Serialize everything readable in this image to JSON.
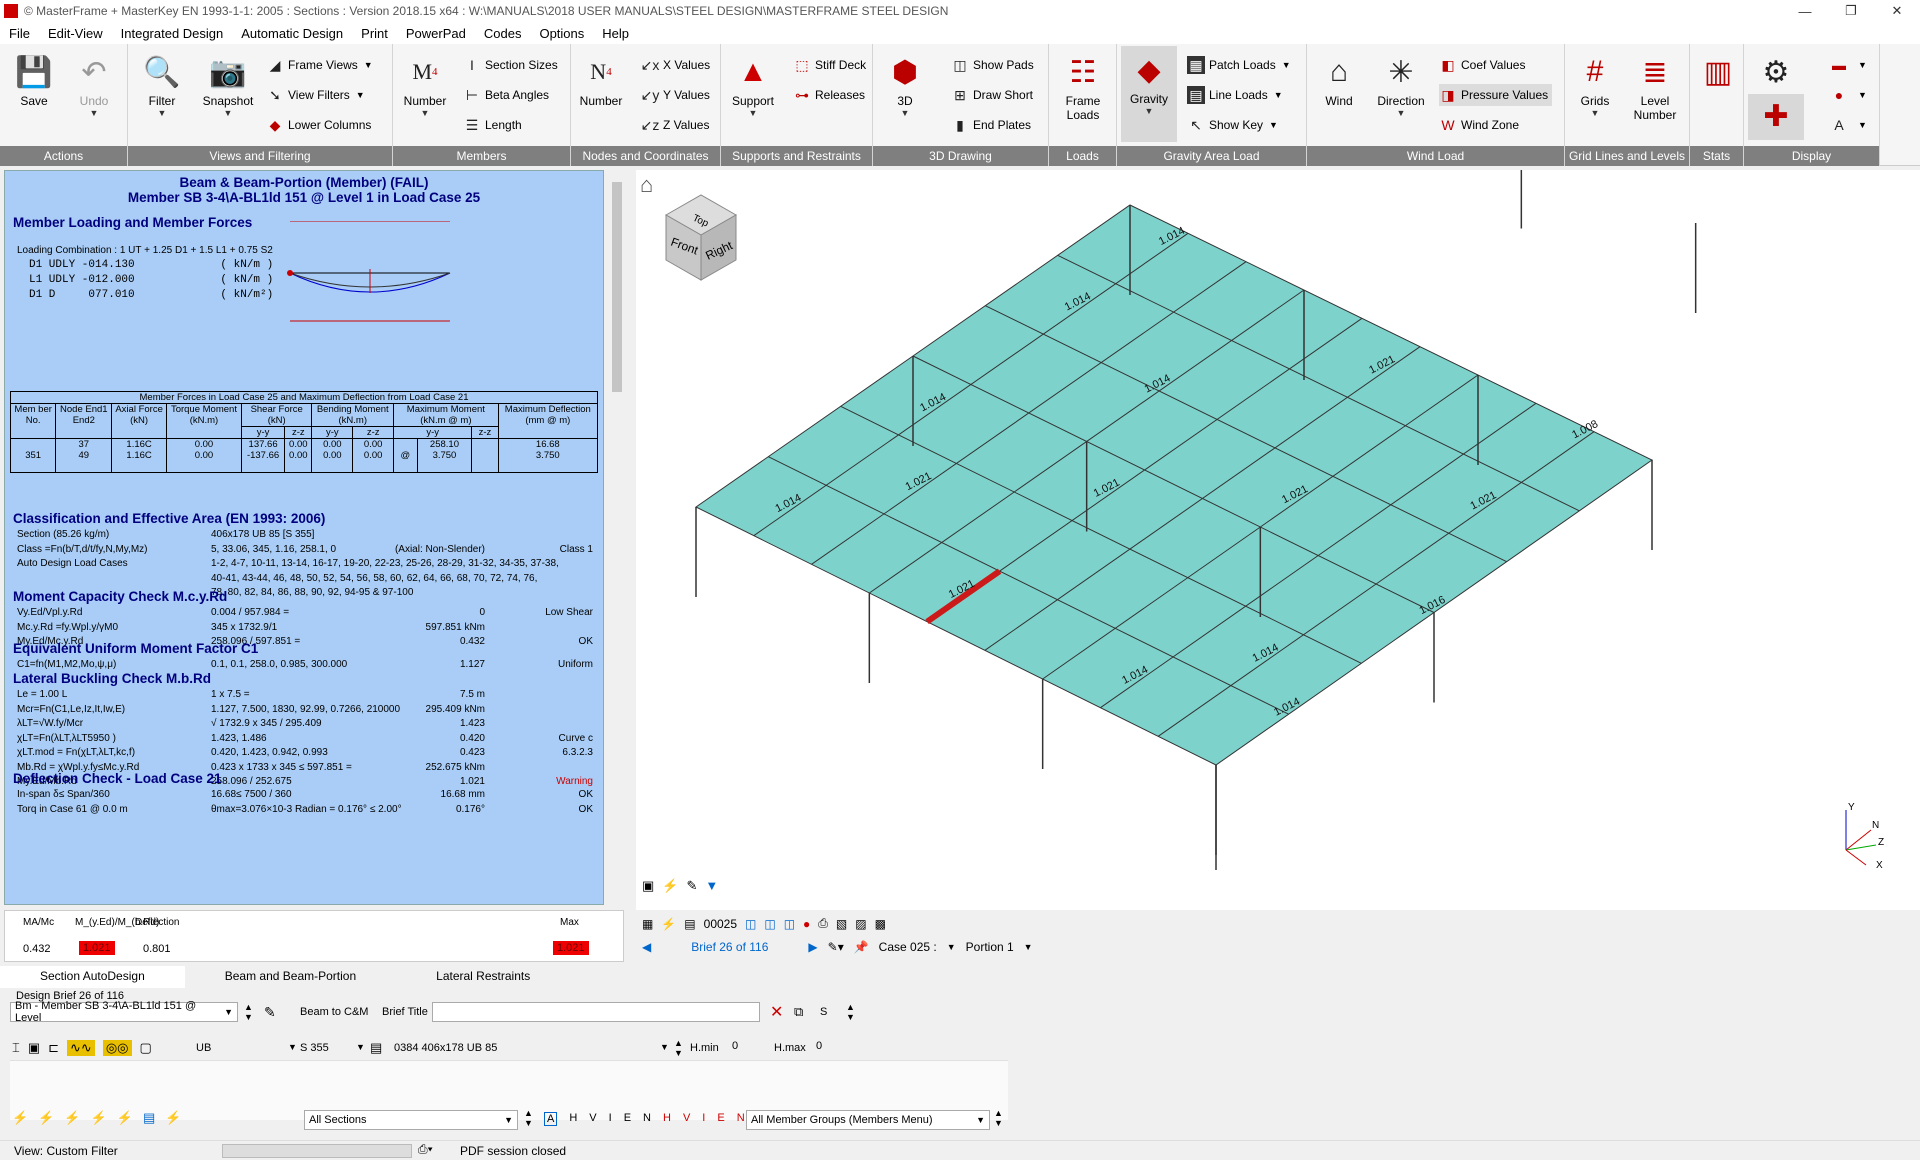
{
  "title_bar": {
    "text": "© MasterFrame + MasterKey EN 1993-1-1: 2005 : Sections : Version 2018.15 x64 : W:\\MANUALS\\2018 USER MANUALS\\STEEL DESIGN\\MASTERFRAME STEEL DESIGN"
  },
  "menu": [
    "File",
    "Edit-View",
    "Integrated Design",
    "Automatic Design",
    "Print",
    "PowerPad",
    "Codes",
    "Options",
    "Help"
  ],
  "ribbon": {
    "actions": {
      "title": "Actions",
      "save": "Save",
      "undo": "Undo"
    },
    "views": {
      "title": "Views and Filtering",
      "filter": "Filter",
      "snapshot": "Snapshot",
      "frame_views": "Frame Views",
      "view_filters": "View Filters",
      "lower_columns": "Lower Columns"
    },
    "members": {
      "title": "Members",
      "number": "Number",
      "section_sizes": "Section Sizes",
      "beta_angles": "Beta Angles",
      "length": "Length"
    },
    "nodes": {
      "title": "Nodes and Coordinates",
      "number": "Number",
      "x_values": "X Values",
      "y_values": "Y Values",
      "z_values": "Z Values"
    },
    "supports": {
      "title": "Supports and Restraints",
      "support": "Support",
      "stiff_deck": "Stiff Deck",
      "releases": "Releases"
    },
    "drawing": {
      "title": "3D Drawing",
      "btn_3d": "3D",
      "show_pads": "Show Pads",
      "draw_short": "Draw Short",
      "end_plates": "End Plates"
    },
    "loads": {
      "title": "Loads",
      "frame_loads": "Frame Loads"
    },
    "gravity": {
      "title": "Gravity Area Load",
      "gravity": "Gravity",
      "patch_loads": "Patch Loads",
      "line_loads": "Line Loads",
      "show_key": "Show Key"
    },
    "wind": {
      "title": "Wind Load",
      "wind": "Wind",
      "direction": "Direction",
      "coef_values": "Coef Values",
      "pressure_values": "Pressure Values",
      "wind_zone": "Wind Zone"
    },
    "grid": {
      "title": "Grid Lines and Levels",
      "grids": "Grids",
      "level_number": "Level Number"
    },
    "stats": {
      "title": "Stats"
    },
    "display": {
      "title": "Display"
    }
  },
  "report": {
    "title1": "Beam & Beam-Portion (Member) (FAIL)",
    "title2": "Member SB 3-4\\A-BL1ld 151 @ Level 1 in Load Case  25",
    "loading_header": "Member Loading and Member Forces",
    "loading_combo": "Loading Combination : 1 UT + 1.25 D1 + 1.5 L1 + 0.75 S2",
    "loads": [
      "D1 UDLY -014.130             ( kN/m )",
      "L1 UDLY -012.000             ( kN/m )",
      "D1 D     077.010             ( kN/m²)"
    ],
    "table_title": "Member Forces in Load Case 25 and Maximum Deflection from Load Case 21",
    "table_headers": {
      "mem": "Mem ber No.",
      "node": "Node End1 End2",
      "axial": "Axial Force (kN)",
      "torque": "Torque Moment (kN.m)",
      "shear": "Shear Force (kN)",
      "bending": "Bending Moment (kN.m)",
      "maxmom": "Maximum Moment (kN.m @ m)",
      "defl": "Maximum Deflection (mm @ m)",
      "yy": "y-y",
      "zz": "z-z"
    },
    "table_row": {
      "mem": "351",
      "node1": "37",
      "node2": "49",
      "axial1": "1.16C",
      "axial2": "1.16C",
      "torque1": "0.00",
      "torque2": "0.00",
      "shy1": "137.66",
      "shy2": "-137.66",
      "shz1": "0.00",
      "shz2": "0.00",
      "bmy1": "0.00",
      "bmy2": "0.00",
      "bmz1": "0.00",
      "bmz2": "0.00",
      "mm1": "258.10",
      "mm2": "3.750",
      "at": "@",
      "d1": "16.68",
      "d2": "3.750"
    },
    "class_header": "Classification and Effective Area (EN 1993: 2006)",
    "class_rows": [
      [
        "Section (85.26 kg/m)",
        "406x178 UB 85 [S 355]",
        "",
        ""
      ],
      [
        "Class =Fn(b/T,d/t/fy,N,My,Mz)",
        "5, 33.06, 345, 1.16, 258.1, 0",
        "(Axial: Non-Slender)",
        "Class 1"
      ],
      [
        "Auto Design Load Cases",
        "1-2, 4-7, 10-11, 13-14, 16-17, 19-20, 22-23, 25-26, 28-29, 31-32, 34-35, 37-38,",
        "",
        ""
      ],
      [
        "",
        "40-41, 43-44, 46, 48, 50, 52, 54, 56, 58, 60, 62, 64, 66, 68, 70, 72, 74, 76,",
        "",
        ""
      ],
      [
        "",
        "78, 80, 82, 84, 86, 88, 90, 92, 94-95 & 97-100",
        "",
        ""
      ]
    ],
    "moment_header": "Moment Capacity Check M.c.y.Rd",
    "moment_rows": [
      [
        "Vy.Ed/Vpl.y.Rd",
        "0.004 / 957.984 =",
        "0",
        "Low Shear"
      ],
      [
        "Mc.y.Rd =fy.Wpl.y/γM0",
        "345 x 1732.9/1",
        "597.851 kNm",
        ""
      ],
      [
        "My.Ed/Mc.y.Rd",
        "258.096 / 597.851 =",
        "0.432",
        "OK"
      ]
    ],
    "eq_header": "Equivalent Uniform Moment Factor C1",
    "eq_rows": [
      [
        "C1=fn(M1,M2,Mo,ψ,μ)",
        "0.1, 0.1, 258.0, 0.985, 300.000",
        "1.127",
        "Uniform"
      ]
    ],
    "ltb_header": "Lateral Buckling Check M.b.Rd",
    "ltb_rows": [
      [
        "Le = 1.00 L",
        "1 x 7.5 =",
        "7.5 m",
        ""
      ],
      [
        "Mcr=Fn(C1,Le,Iz,It,Iw,E)",
        "1.127, 7.500, 1830, 92.99, 0.7266, 210000",
        "295.409 kNm",
        ""
      ],
      [
        "λLT=√W.fy/Mcr",
        "√ 1732.9 x 345 / 295.409",
        "1.423",
        ""
      ],
      [
        "χLT=Fn(λLT,λLT5950 )",
        "1.423, 1.486",
        "0.420",
        "Curve c"
      ],
      [
        "χLT.mod = Fn(χLT,λLT,kc,f)",
        "0.420, 1.423, 0.942, 0.993",
        "0.423",
        "6.3.2.3"
      ],
      [
        "Mb.Rd = χWpl.y.fy≤Mc.y.Rd",
        "0.423 x 1733 x 345 ≤ 597.851 =",
        "252.675 kNm",
        ""
      ],
      [
        "My.Ed/Mb.Rd",
        "258.096 / 252.675",
        "1.021",
        "Warning"
      ]
    ],
    "defl_header": "Deflection Check - Load Case 21",
    "defl_rows": [
      [
        "In-span δ≤ Span/360",
        "16.68≤ 7500 / 360",
        "16.68 mm",
        "OK"
      ],
      [
        "Torq in Case 61 @ 0.0 m",
        "θmax=3.076×10-3 Radian = 0.176° ≤ 2.00°",
        "0.176°",
        "OK"
      ]
    ]
  },
  "summary": {
    "h1": "MA/Mc",
    "h2": "M_(y.Ed)/M_(b.Rd)",
    "h3": "Deflection",
    "h4": "Max",
    "v1": "0.432",
    "v2": "1.021",
    "v3": "0.801",
    "v4": "1.021"
  },
  "viewcube": {
    "top": "Top",
    "front": "Front",
    "right": "Right"
  },
  "model_labels": [
    "1.014",
    "1.014",
    "1.014",
    "1.014",
    "1.021",
    "1.021",
    "1.021",
    "1.021",
    "1.021",
    "1.021",
    "1.008",
    "1.016",
    "1.014",
    "1.014",
    "1.014",
    "1.014"
  ],
  "controls": {
    "code": "00025",
    "brief": "Brief 26 of 116",
    "case": "Case 025 :",
    "portion": "Portion 1"
  },
  "tabs": [
    "Section AutoDesign",
    "Beam and Beam-Portion",
    "Lateral Restraints"
  ],
  "lower": {
    "design_brief": "Design Brief 26 of 116",
    "member_select": "Bm - Member SB 3-4\\A-BL1ld 151 @ Level",
    "beam_cm": "Beam to C&M",
    "brief_title": "Brief Title",
    "s": "S",
    "ub": "UB",
    "grade": "S 355",
    "section": "0384 406x178 UB 85",
    "hmin": "H.min",
    "hmin_v": "0",
    "hmax": "H.max",
    "hmax_v": "0",
    "all_sections": "All Sections",
    "letters": [
      "A",
      "H",
      "V",
      "I",
      "E",
      "N"
    ],
    "letters_red": [
      "H",
      "V",
      "I",
      "E",
      "N"
    ],
    "groups": "All Member Groups (Members Menu)"
  },
  "status": {
    "view": "View: Custom Filter",
    "pdf": "PDF session closed"
  },
  "colors": {
    "panel_bg": "#a9cdf6",
    "floor": "#7dd3cc",
    "fail_red": "#cc1a1a",
    "ribbon_group": "#7f7f7f",
    "heading_blue": "#00007f"
  }
}
